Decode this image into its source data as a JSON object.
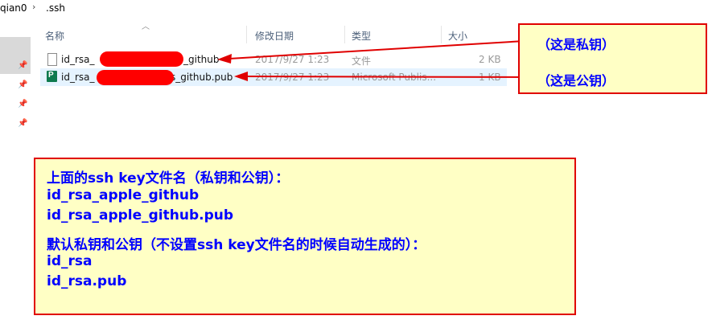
{
  "breadcrumb": {
    "parent": "qian0",
    "separator": "›",
    "current": ".ssh"
  },
  "columns": {
    "name": "名称",
    "modified": "修改日期",
    "type": "类型",
    "size": "大小"
  },
  "files": [
    {
      "name_prefix": "id_rsa_",
      "name_suffix": "_github",
      "modified": "2017/9/27 1:23",
      "type": "文件",
      "size": "2 KB"
    },
    {
      "name_prefix": "id_rsa_",
      "name_suffix": "s_github.pub",
      "modified": "2017/9/27 1:23",
      "type": "Microsoft Publis...",
      "size": "1 KB"
    }
  ],
  "callouts": {
    "private_key": "（这是私钥）",
    "public_key": "（这是公钥）"
  },
  "notes": {
    "line1": "上面的ssh key文件名（私钥和公钥）：",
    "line2": "id_rsa_apple_github",
    "line3": "id_rsa_apple_github.pub",
    "line4": "默认私钥和公钥（不设置ssh key文件名的时候自动生成的）：",
    "line5": "id_rsa",
    "line6": "id_rsa.pub"
  },
  "colors": {
    "annotation_red": "#e00000",
    "callout_fill": "#ffffc5",
    "callout_text": "#0000ff",
    "selected_row": "#e5f3ff"
  },
  "icons": {
    "file": "file-icon",
    "publisher": "publisher-file-icon",
    "pin": "pin-icon"
  }
}
